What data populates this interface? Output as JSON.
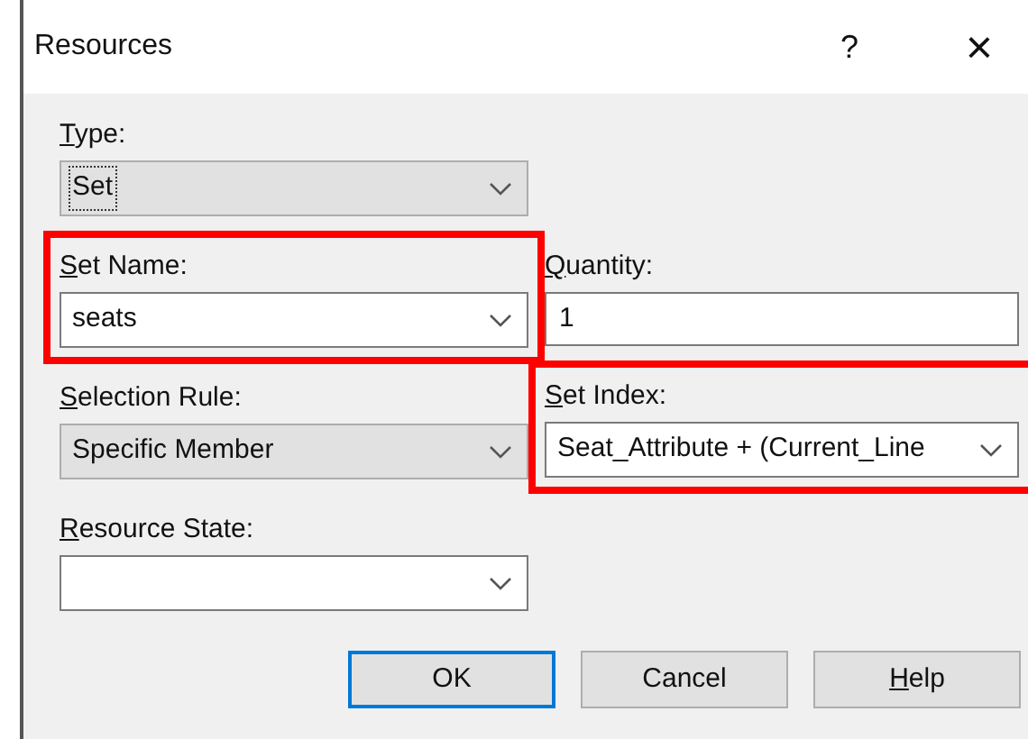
{
  "window": {
    "title": "Resources",
    "help_glyph": "?",
    "close_glyph": "×"
  },
  "left_fields": [
    {
      "label": "Type:",
      "accelerator": true,
      "kind": "combo",
      "editable": false,
      "focused": true,
      "highlighted": false,
      "value": "Set"
    },
    {
      "label": "Set Name:",
      "accelerator": true,
      "kind": "combo",
      "editable": true,
      "highlighted": true,
      "value": "seats"
    },
    {
      "label": "Selection Rule:",
      "accelerator": true,
      "kind": "combo",
      "editable": false,
      "highlighted": false,
      "value": "Specific Member"
    },
    {
      "label": "Resource State:",
      "accelerator": true,
      "kind": "combo",
      "editable": true,
      "highlighted": false
    }
  ],
  "right_fields": [
    {
      "label": "Quantity:",
      "accelerator": true,
      "kind": "text",
      "editable": true,
      "highlighted": false,
      "value": "1"
    },
    {
      "label": "Set Index:",
      "accelerator": true,
      "kind": "combo",
      "editable": true,
      "highlighted": true,
      "value": "Seat_Attribute + (Current_Line"
    }
  ],
  "buttons": [
    {
      "label": "OK",
      "accelerator": false,
      "default": true
    },
    {
      "label": "Cancel",
      "accelerator": false,
      "default": false
    },
    {
      "label": "Help",
      "accelerator": true,
      "default": false
    }
  ]
}
